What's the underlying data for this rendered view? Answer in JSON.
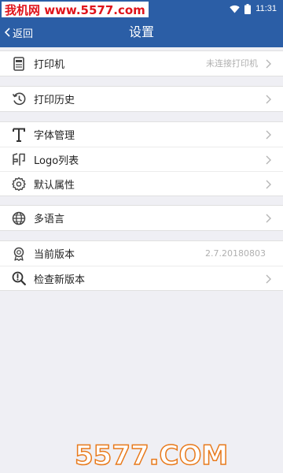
{
  "watermark": {
    "top": "我机网 www.5577.com",
    "bottom": "5577.COM"
  },
  "status_bar": {
    "time": "11:31"
  },
  "nav": {
    "back_label": "返回",
    "title": "设置"
  },
  "groups": [
    [
      {
        "icon": "printer-icon",
        "label": "打印机",
        "value": "未连接打印机",
        "chevron": true
      }
    ],
    [
      {
        "icon": "history-icon",
        "label": "打印历史",
        "value": "",
        "chevron": true
      }
    ],
    [
      {
        "icon": "font-icon",
        "label": "字体管理",
        "value": "",
        "chevron": true
      },
      {
        "icon": "stamp-icon",
        "label": "Logo列表",
        "value": "",
        "chevron": true
      },
      {
        "icon": "gear-icon",
        "label": "默认属性",
        "value": "",
        "chevron": true
      }
    ],
    [
      {
        "icon": "globe-icon",
        "label": "多语言",
        "value": "",
        "chevron": true
      }
    ],
    [
      {
        "icon": "award-icon",
        "label": "当前版本",
        "value": "2.7.20180803",
        "chevron": false
      },
      {
        "icon": "search-update-icon",
        "label": "检查新版本",
        "value": "",
        "chevron": true
      }
    ]
  ],
  "colors": {
    "nav_bg": "#2b5ea6",
    "page_bg": "#efeff4",
    "watermark_red": "#e0141b",
    "watermark_orange": "#e87a1c"
  }
}
